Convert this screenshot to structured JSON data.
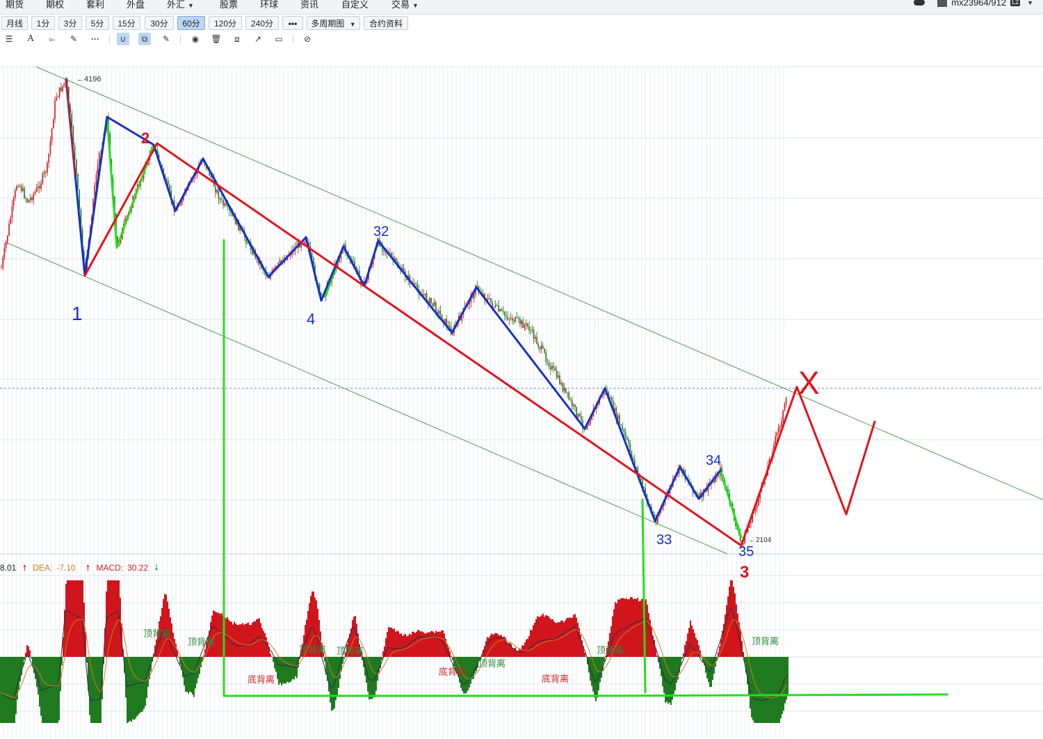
{
  "menu": [
    {
      "label": "期货"
    },
    {
      "label": "期权"
    },
    {
      "label": "套利"
    },
    {
      "label": "外盘"
    },
    {
      "label": "外汇",
      "dropdown": true
    },
    {
      "label": "股票"
    },
    {
      "label": "环球"
    },
    {
      "label": "资讯"
    },
    {
      "label": "自定义"
    },
    {
      "label": "交易",
      "dropdown": true
    }
  ],
  "user": {
    "name": "mx23964/912",
    "badge": "L2"
  },
  "periods": [
    "月线",
    "1分",
    "3分",
    "5分",
    "15分",
    "30分",
    "60分",
    "120分",
    "240分",
    "•••",
    "多周期图",
    "合约资料"
  ],
  "active_period": "60分",
  "price_labels": {
    "high": "←4196",
    "low": "←2104"
  },
  "macd": {
    "diff": "8.01",
    "dea_label": "DEA:",
    "dea": "-7.10",
    "macd_label": "MACD:",
    "macd": "30.22"
  },
  "divergence_labels": [
    "顶背离",
    "顶背离",
    "顶背离",
    "顶背离",
    "顶背离",
    "顶背离",
    "顶背离",
    "底背离",
    "底背离",
    "底背离"
  ],
  "annotations": [
    "1",
    "2",
    "3",
    "4",
    "32",
    "33",
    "34",
    "35",
    "X"
  ],
  "colors": {
    "up": "#d0161c",
    "down": "#1f7a1f",
    "wave_blue": "#1730c6",
    "wave_red": "#e0151c",
    "wave_green": "#22e01a",
    "channel": "#4f9a4f",
    "dashed": "#5b86c9",
    "active_tab": "#bcd6f4"
  }
}
